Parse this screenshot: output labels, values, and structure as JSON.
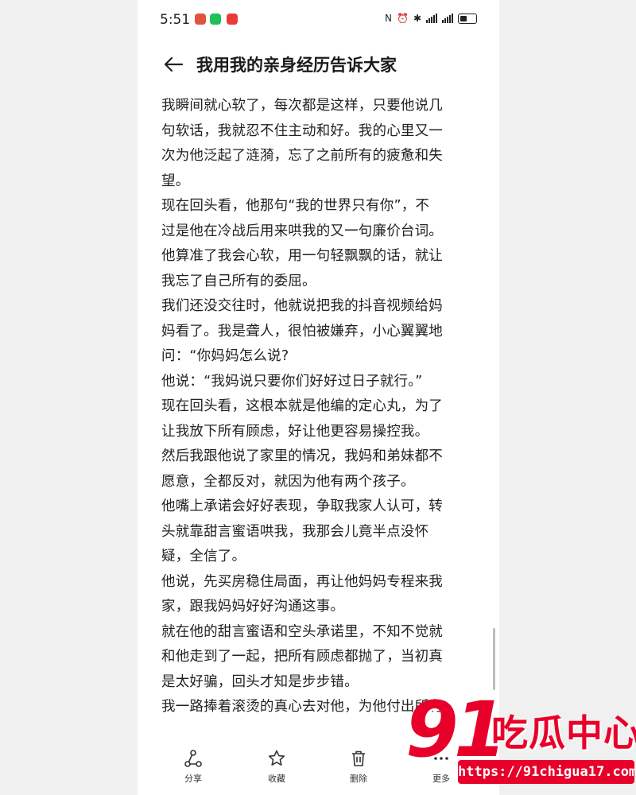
{
  "status_bar": {
    "time": "5:51"
  },
  "header": {
    "title": "我用我的亲身经历告诉大家"
  },
  "article": {
    "lines": [
      "我瞬间就心软了，每次都是这样，只要他说几",
      "句软话，我就忍不住主动和好。我的心里又一",
      "次为他泛起了涟漪，忘了之前所有的疲惫和失",
      "望。",
      " 现在回头看，他那句“我的世界只有你”，不",
      "过是他在冷战后用来哄我的又一句廉价台词。",
      "他算准了我会心软，用一句轻飘飘的话，就让",
      "我忘了自己所有的委屈。",
      "我们还没交往时，他就说把我的抖音视频给妈",
      "妈看了。我是聋人，很怕被嫌弃，小心翼翼地",
      "问：“你妈妈怎么说?",
      "他说：“我妈说只要你们好好过日子就行。”",
      "现在回头看，这根本就是他编的定心丸，为了",
      "让我放下所有顾虑，好让他更容易操控我。",
      "然后我跟他说了家里的情况，我妈和弟妹都不",
      "愿意，全都反对，就因为他有两个孩子。",
      "他嘴上承诺会好好表现，争取我家人认可，转",
      "头就靠甜言蜜语哄我，我那会儿竟半点没怀",
      "疑，全信了。",
      "他说，先买房稳住局面，再让他妈妈专程来我",
      "家，跟我妈妈好好沟通这事。",
      "就在他的甜言蜜语和空头承诺里，不知不觉就",
      "和他走到了一起，把所有顾虑都抛了，当初真",
      "是太好骗，回头才知是步步错。",
      "我一路捧着滚烫的真心去对他，为他付出所有"
    ]
  },
  "toolbar": {
    "share": "分享",
    "favorite": "收藏",
    "delete": "删除",
    "more": "更多"
  },
  "watermark_logo": {
    "number": "91",
    "name": "吃瓜中心",
    "url": "https://91chigua17.com"
  },
  "colors": {
    "brand_red": "#e8002a",
    "text": "#222222",
    "background": "#ffffff"
  }
}
